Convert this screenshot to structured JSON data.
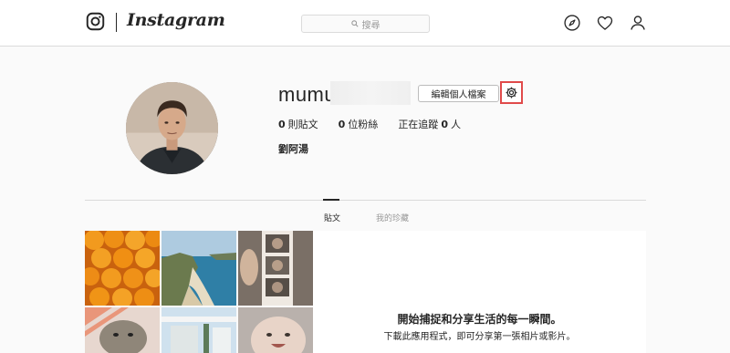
{
  "header": {
    "logo_text": "Instagram",
    "search_placeholder": "搜尋"
  },
  "profile": {
    "username": "mumu",
    "edit_profile_label": "編輯個人檔案",
    "stats": {
      "posts_count": "0",
      "posts_label": "則貼文",
      "followers_count": "0",
      "followers_label": "位粉絲",
      "following_prefix": "正在追蹤",
      "following_count": "0",
      "following_suffix": "人"
    },
    "full_name": "劉阿湯"
  },
  "tabs": [
    {
      "label": "貼文",
      "active": true
    },
    {
      "label": "我的珍藏",
      "active": false
    }
  ],
  "empty_state": {
    "title": "開始捕捉和分享生活的每一瞬間。",
    "subtitle": "下載此應用程式，即可分享第一張相片或影片。"
  },
  "icons": {
    "logo": "instagram-camera-icon",
    "search": "search-icon",
    "explore": "compass-icon",
    "activity": "heart-icon",
    "profile": "person-icon",
    "settings": "gear-icon"
  },
  "colors": {
    "highlight_box": "#e04a4a",
    "border": "#dbdbdb",
    "text": "#262626"
  }
}
